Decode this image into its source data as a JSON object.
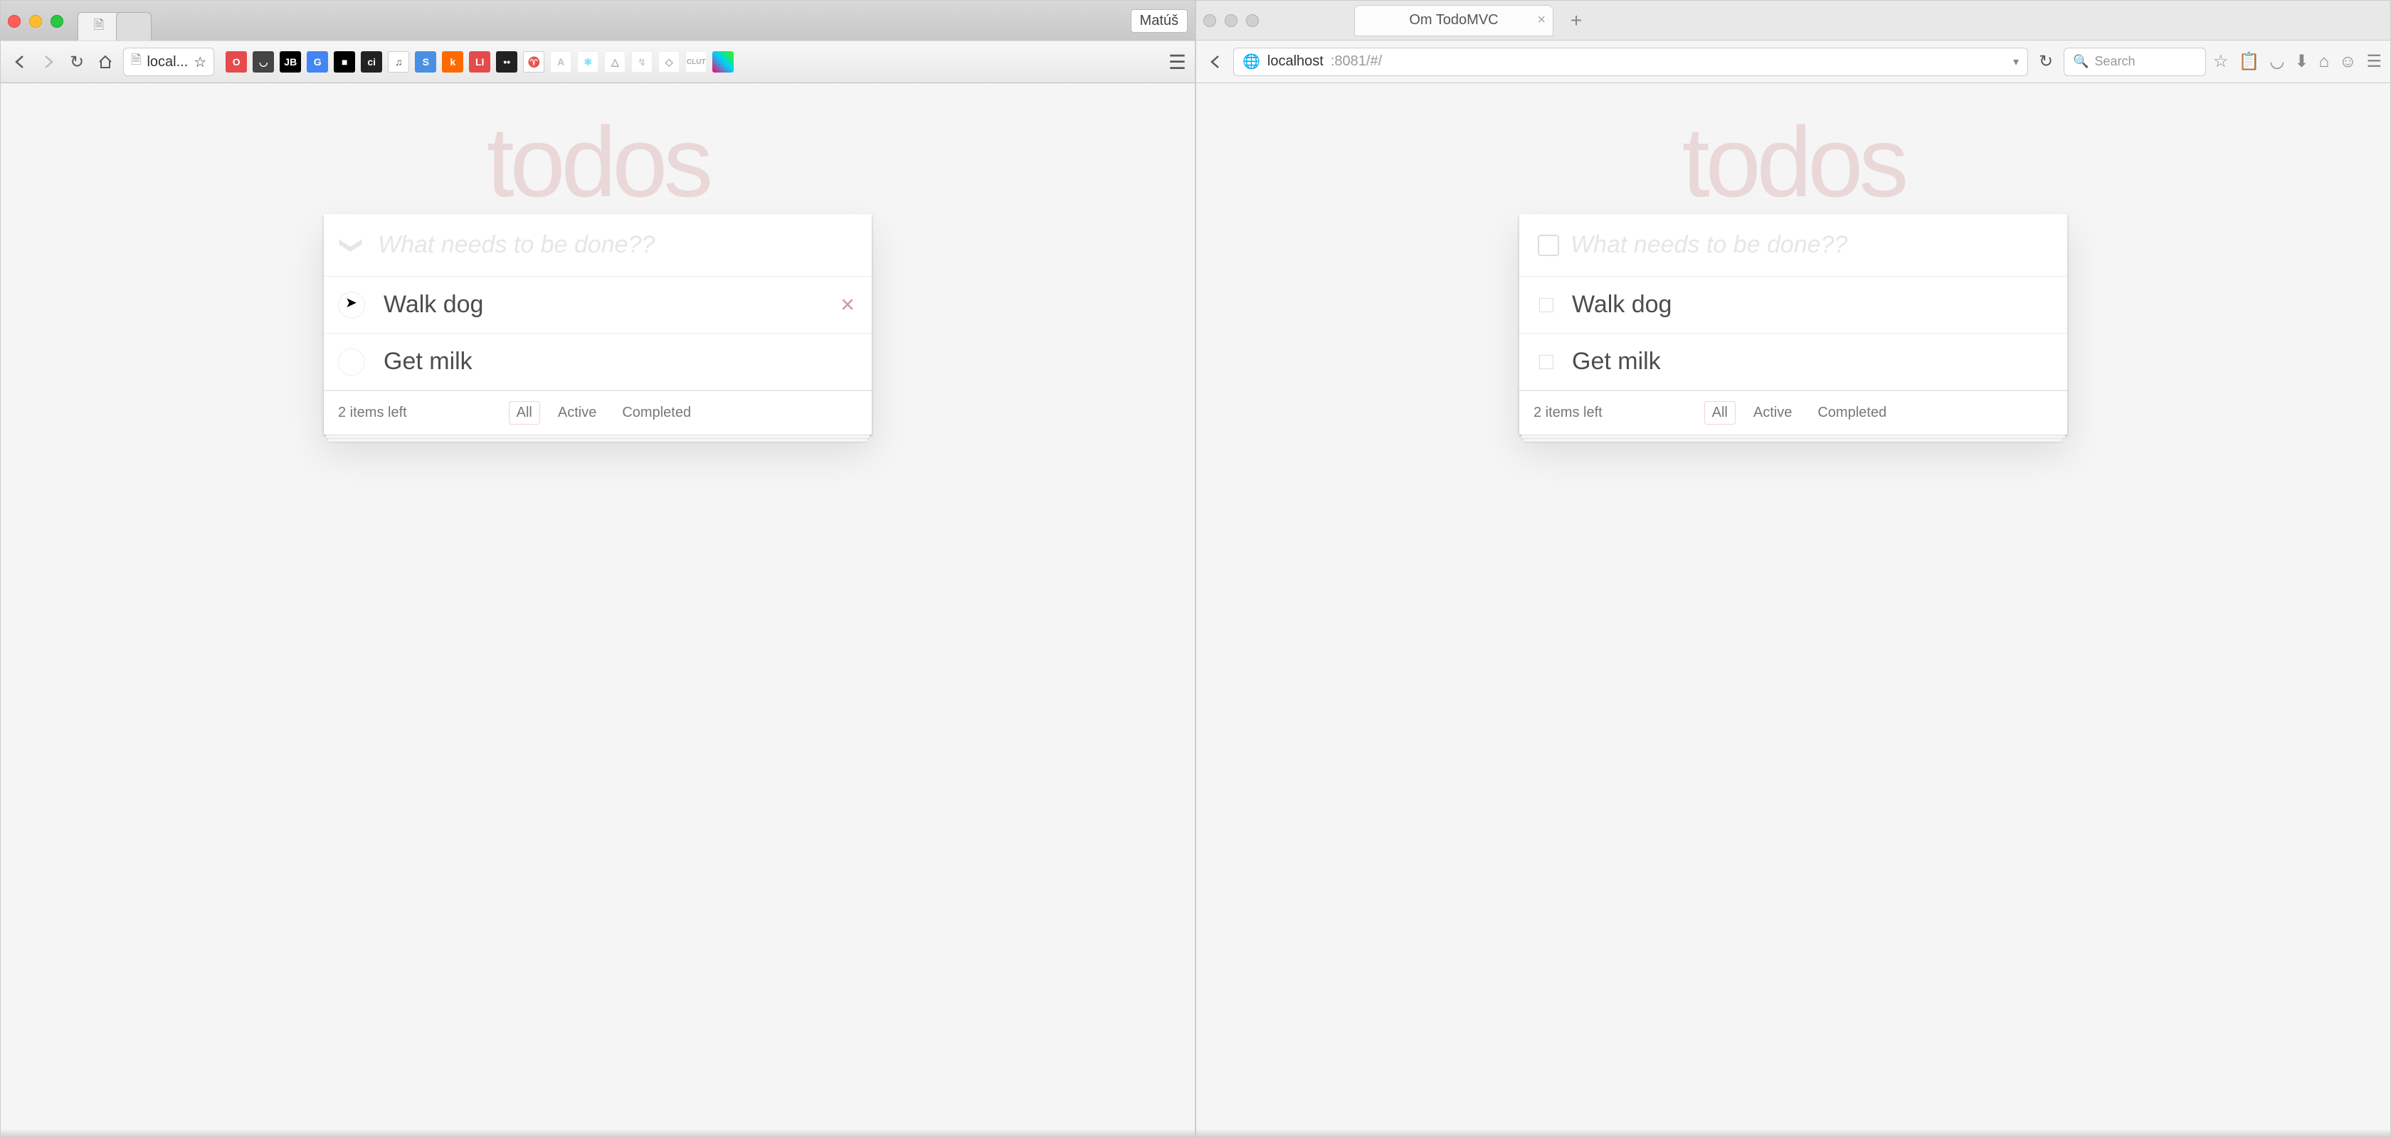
{
  "left_browser": {
    "profile": "Matúš",
    "url_display": "local...",
    "star_icon": "star-icon"
  },
  "right_browser": {
    "tab_title": "Om TodoMVC",
    "url_host": "localhost",
    "url_rest": ":8081/#/",
    "search_placeholder": "Search"
  },
  "app": {
    "title": "todos",
    "new_todo_placeholder": "What needs to be done??",
    "items": [
      {
        "label": "Walk dog",
        "completed": false,
        "show_destroy_left": true
      },
      {
        "label": "Get milk",
        "completed": false,
        "show_destroy_left": false
      }
    ],
    "items_left_text": "2 items left",
    "filters": {
      "all": "All",
      "active": "Active",
      "completed": "Completed",
      "selected": "all"
    }
  }
}
